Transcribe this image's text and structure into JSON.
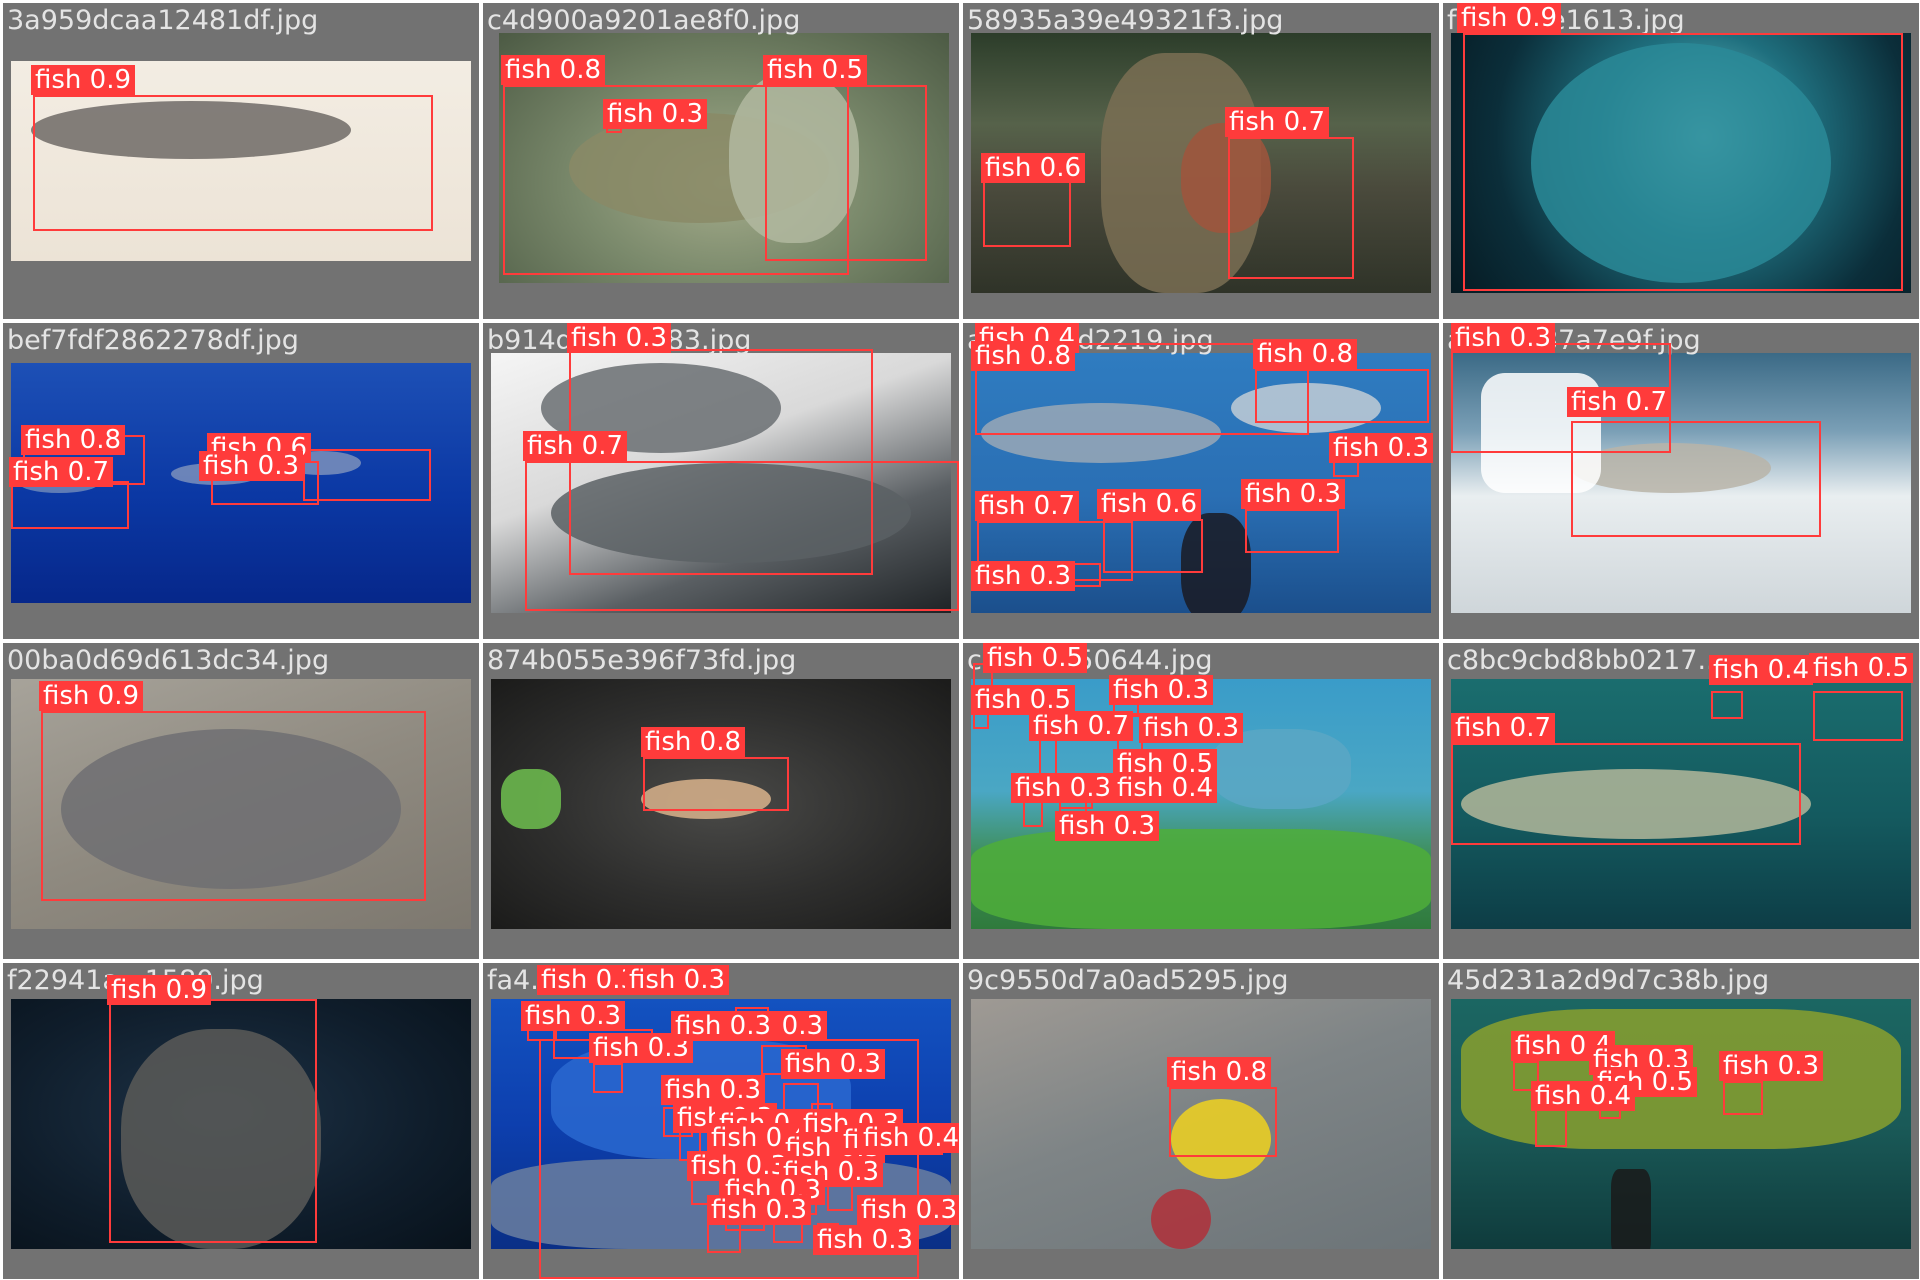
{
  "grid": {
    "label_color": "#ff3b3b",
    "tile_bg": "#727272",
    "tiles": [
      {
        "filename": "3a959dcaa12481df.jpg",
        "scene": "whiting-on-white",
        "detections": [
          {
            "label": "fish 0.9"
          }
        ]
      },
      {
        "filename": "c4d900a9201ae8f0.jpg",
        "scene": "cuttlefish",
        "detections": [
          {
            "label": "fish 0.8"
          },
          {
            "label": "fish 0.3"
          },
          {
            "label": "fish 0.5"
          }
        ]
      },
      {
        "filename": "58935a39e49321f3.jpg",
        "scene": "angler-with-trout",
        "detections": [
          {
            "label": "fish 0.6"
          },
          {
            "label": "fish 0.7"
          }
        ]
      },
      {
        "filename": "f...9821e1613.jpg",
        "scene": "sardine-bait-ball",
        "detections": [
          {
            "label": "fish 0.9"
          }
        ]
      },
      {
        "filename": "bef7fdf2862278df.jpg",
        "scene": "dolphins-blue-water",
        "detections": [
          {
            "label": "fish 0.8"
          },
          {
            "label": "fish 0.7"
          },
          {
            "label": "fish 0.6"
          },
          {
            "label": "fish 0.3"
          }
        ]
      },
      {
        "filename": "b914d...95a583.jpg",
        "scene": "fish-in-bucket",
        "detections": [
          {
            "label": "fish 0.3"
          },
          {
            "label": "fish 0.7"
          }
        ]
      },
      {
        "filename": "a...8e01d2219.jpg",
        "scene": "shark-aquarium",
        "detections": [
          {
            "label": "fish 0.4"
          },
          {
            "label": "fish 0.8"
          },
          {
            "label": "fish 0.8"
          },
          {
            "label": "fish 0.3"
          },
          {
            "label": "fish 0.7"
          },
          {
            "label": "fish 0.6"
          },
          {
            "label": "fish 0.3"
          },
          {
            "label": "fish 0.3"
          }
        ]
      },
      {
        "filename": "a...25187a7e9f.jpg",
        "scene": "boat-catch",
        "detections": [
          {
            "label": "fish 0.3"
          },
          {
            "label": "fish 0.7"
          }
        ]
      },
      {
        "filename": "00ba0d69d613dc34.jpg",
        "scene": "rabbitfish-on-sand",
        "detections": [
          {
            "label": "fish 0.9"
          }
        ]
      },
      {
        "filename": "874b055e396f73fd.jpg",
        "scene": "perch-in-net",
        "detections": [
          {
            "label": "fish 0.8"
          }
        ]
      },
      {
        "filename": "c...210150644.jpg",
        "scene": "kelp-divers",
        "detections": [
          {
            "label": "fish 0.5"
          },
          {
            "label": "fish 0.5"
          },
          {
            "label": "fish 0.3"
          },
          {
            "label": "fish 0.7"
          },
          {
            "label": "fish 0.3"
          },
          {
            "label": "fish 0.5"
          },
          {
            "label": "fish 0.3"
          },
          {
            "label": "fish 0.4"
          },
          {
            "label": "fish 0.3"
          }
        ]
      },
      {
        "filename": "c8bc9cbd8bb0217...",
        "scene": "barracuda",
        "detections": [
          {
            "label": "fish 0.4"
          },
          {
            "label": "fish 0.5"
          },
          {
            "label": "fish 0.7"
          }
        ]
      },
      {
        "filename": "f22941a...1580.jpg",
        "scene": "sunfish-dark",
        "detections": [
          {
            "label": "fish 0.9"
          }
        ]
      },
      {
        "filename": "fa4...",
        "scene": "reef-crowd",
        "detections": [
          {
            "label": "fish 0.3"
          },
          {
            "label": "fish 0.3"
          },
          {
            "label": "fish 0.3"
          },
          {
            "label": "fish 0.3"
          },
          {
            "label": "fish 0.3"
          },
          {
            "label": "fish 0.3"
          },
          {
            "label": "fish 0.3"
          },
          {
            "label": "fish 0.3"
          },
          {
            "label": "fish 0.3"
          },
          {
            "label": "fish 0.3"
          },
          {
            "label": "fish 0.4"
          },
          {
            "label": "fish 0.3"
          },
          {
            "label": "fish 0.5"
          },
          {
            "label": "fish 0.3"
          },
          {
            "label": "fish 0.3"
          },
          {
            "label": "fish 0.3"
          },
          {
            "label": "fish 0.3"
          },
          {
            "label": "fish 0.3"
          },
          {
            "label": "fish 0.4"
          },
          {
            "label": "fish 0.3"
          },
          {
            "label": "fish 0.3"
          }
        ]
      },
      {
        "filename": "9c9550d7a0ad5295.jpg",
        "scene": "yellow-tang",
        "detections": [
          {
            "label": "fish 0.8"
          }
        ]
      },
      {
        "filename": "45d231a2d9d7c38b.jpg",
        "scene": "aquarium-kelp",
        "detections": [
          {
            "label": "fish 0.4"
          },
          {
            "label": "fish 0.3"
          },
          {
            "label": "fish 0.5"
          },
          {
            "label": "fish 0.3"
          },
          {
            "label": "fish 0.4"
          }
        ]
      }
    ]
  }
}
